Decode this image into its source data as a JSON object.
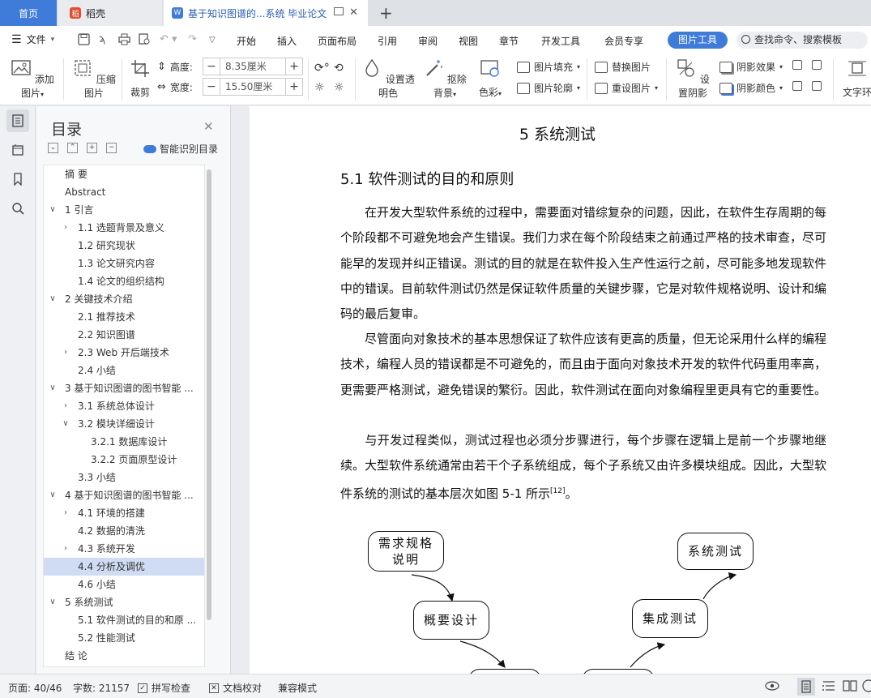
{
  "tabs": {
    "home": "首页",
    "daoke": "稻壳",
    "doc": "基于知识图谱的...系统 毕业论文"
  },
  "menu": {
    "file": "文件",
    "items": [
      "开始",
      "插入",
      "页面布局",
      "引用",
      "审阅",
      "视图",
      "章节",
      "开发工具",
      "会员专享"
    ],
    "picture_tools": "图片工具",
    "search": "查找命令、搜索模板"
  },
  "ribbon": {
    "add_picture": "添加图片",
    "compress": "压缩图片",
    "crop": "裁剪",
    "height_label": "高度:",
    "height_value": "8.35厘米",
    "width_label": "宽度:",
    "width_value": "15.50厘米",
    "transparency": "设置透明色",
    "remove_bg": "抠除背景",
    "color": "色彩",
    "fill": "图片填充",
    "outline": "图片轮廓",
    "replace": "替换图片",
    "reset": "重设图片",
    "shadow": "设置阴影",
    "shadow_effect": "阴影效果",
    "shadow_color": "阴影颜色",
    "wrap": "文字环"
  },
  "toc": {
    "title": "目录",
    "smart": "智能识别目录",
    "items": [
      {
        "text": "摘    要",
        "level": 0,
        "chev": ""
      },
      {
        "text": "Abstract",
        "level": 0,
        "chev": ""
      },
      {
        "text": "1  引言",
        "level": 0,
        "chev": "v"
      },
      {
        "text": "1.1 选题背景及意义",
        "level": 1,
        "chev": ">"
      },
      {
        "text": "1.2 研究现状",
        "level": 1,
        "chev": ""
      },
      {
        "text": "1.3  论文研究内容",
        "level": 1,
        "chev": ""
      },
      {
        "text": "1.4  论文的组织结构",
        "level": 1,
        "chev": ""
      },
      {
        "text": "2  关键技术介绍",
        "level": 0,
        "chev": "v"
      },
      {
        "text": "2.1 推荐技术",
        "level": 1,
        "chev": ""
      },
      {
        "text": "2.2 知识图谱",
        "level": 1,
        "chev": ""
      },
      {
        "text": "2.3 Web 开后端技术",
        "level": 1,
        "chev": ">"
      },
      {
        "text": "2.4  小结",
        "level": 1,
        "chev": ""
      },
      {
        "text": "3  基于知识图谱的图书智能 ...",
        "level": 0,
        "chev": "v"
      },
      {
        "text": "3.1  系统总体设计",
        "level": 1,
        "chev": ">"
      },
      {
        "text": "3.2  模块详细设计",
        "level": 1,
        "chev": "v"
      },
      {
        "text": "3.2.1  数据库设计",
        "level": 2,
        "chev": ""
      },
      {
        "text": "3.2.2  页面原型设计",
        "level": 2,
        "chev": ""
      },
      {
        "text": "3.3  小结",
        "level": 1,
        "chev": ""
      },
      {
        "text": "4  基于知识图谱的图书智能 ...",
        "level": 0,
        "chev": "v"
      },
      {
        "text": "4.1  环境的搭建",
        "level": 1,
        "chev": ">"
      },
      {
        "text": "4.2  数据的清洗",
        "level": 1,
        "chev": ""
      },
      {
        "text": "4.3  系统开发",
        "level": 1,
        "chev": ">"
      },
      {
        "text": "4.4  分析及调优",
        "level": 1,
        "chev": "",
        "selected": true
      },
      {
        "text": "4.6  小结",
        "level": 1,
        "chev": ""
      },
      {
        "text": "5  系统测试",
        "level": 0,
        "chev": "v"
      },
      {
        "text": "5.1  软件测试的目的和原 ...",
        "level": 1,
        "chev": ""
      },
      {
        "text": "5.2  性能测试",
        "level": 1,
        "chev": ""
      },
      {
        "text": "结    论",
        "level": 0,
        "chev": ""
      }
    ]
  },
  "doc": {
    "chapter_title": "5  系统测试",
    "section_title": "5.1  软件测试的目的和原则",
    "para1": "在开发大型软件系统的过程中，需要面对错综复杂的问题，因此，在软件生存周期的每个阶段都不可避免地会产生错误。我们力求在每个阶段结束之前通过严格的技术审查，尽可能早的发现并纠正错误。测试的目的就是在软件投入生产性运行之前，尽可能多地发现软件中的错误。目前软件测试仍然是保证软件质量的关键步骤，它是对软件规格说明、设计和编码的最后复审。",
    "para2": "尽管面向对象技术的基本思想保证了软件应该有更高的质量，但无论采用什么样的编程技术，编程人员的错误都是不可避免的，而且由于面向对象技术开发的软件代码重用率高，更需要严格测试，避免错误的繁衍。因此，软件测试在面向对象编程里更具有它的重要性。",
    "para3": "与开发过程类似，测试过程也必须分步骤进行，每个步骤在逻辑上是前一个步骤地继续。大型软件系统通常由若干个子系统组成，每个子系统又由许多模块组成。因此，大型软件系统的测试的基本层次如图 5-1 所示",
    "para3_ref": "[12]",
    "para3_end": "。",
    "diagram": {
      "req": "需求规格说明",
      "sys": "系统测试",
      "outline": "概要设计",
      "integ": "集成测试"
    }
  },
  "status": {
    "page": "页面: 40/46",
    "words": "字数: 21157",
    "spell": "拼写检查",
    "proof": "文档校对",
    "compat": "兼容模式"
  }
}
